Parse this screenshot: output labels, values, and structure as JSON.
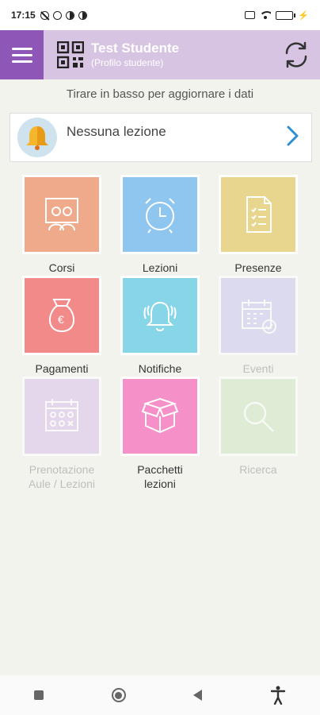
{
  "status_bar": {
    "time": "17:15",
    "battery_level": 0.9
  },
  "header": {
    "title": "Test Studente",
    "subtitle": "(Profilo studente)"
  },
  "hint": "Tirare in basso per aggiornare i dati",
  "lesson_card": {
    "text": "Nessuna lezione"
  },
  "tiles": [
    {
      "label": "Corsi",
      "color": "#efa98b",
      "icon": "people-board-icon"
    },
    {
      "label": "Lezioni",
      "color": "#8ec6f0",
      "icon": "alarm-clock-icon"
    },
    {
      "label": "Presenze",
      "color": "#e8d58e",
      "icon": "checklist-document-icon"
    },
    {
      "label": "Pagamenti",
      "color": "#f28a8a",
      "icon": "money-bag-icon"
    },
    {
      "label": "Notifiche",
      "color": "#86d6e8",
      "icon": "bell-icon"
    },
    {
      "label": "Eventi",
      "color": "#c9c6ef",
      "icon": "calendar-check-icon"
    },
    {
      "label": "Prenotazione Aule / Lezioni",
      "color": "#d8c1ec",
      "icon": "calendar-grid-icon"
    },
    {
      "label": "Pacchetti lezioni",
      "color": "#f590c8",
      "icon": "open-box-icon"
    },
    {
      "label": "Ricerca",
      "color": "#cde8c4",
      "icon": "search-icon"
    }
  ],
  "colors": {
    "accent": "#8e57b7",
    "header_bg": "#d7c4e3",
    "chevron": "#2f8fd0"
  }
}
